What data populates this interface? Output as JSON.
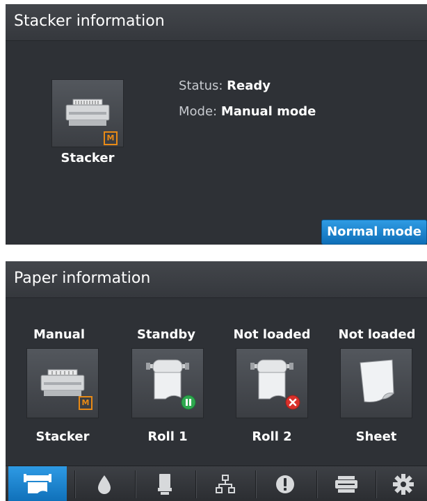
{
  "stacker_panel": {
    "title": "Stacker information",
    "tile_label": "Stacker",
    "badge": "M",
    "status_key": "Status:",
    "status_value": "Ready",
    "mode_key": "Mode:",
    "mode_value": "Manual mode",
    "normal_mode_button": "Normal mode"
  },
  "paper_panel": {
    "title": "Paper information",
    "tiles": [
      {
        "status": "Manual",
        "label": "Stacker",
        "icon": "stacker-icon",
        "badge": "M"
      },
      {
        "status": "Standby",
        "label": "Roll 1",
        "icon": "roll-icon",
        "badge": "pause"
      },
      {
        "status": "Not loaded",
        "label": "Roll 2",
        "icon": "roll-icon",
        "badge": "error"
      },
      {
        "status": "Not loaded",
        "label": "Sheet",
        "icon": "sheet-icon",
        "badge": ""
      }
    ]
  },
  "nav": {
    "items": [
      "paper-icon",
      "ink-drop-icon",
      "printhead-icon",
      "network-icon",
      "alert-icon",
      "printer-icon",
      "settings-gear-icon"
    ],
    "active_index": 0
  },
  "colors": {
    "panel_bg": "#2e3136",
    "accent_blue": "#1a85d0",
    "badge_orange": "#e88a16",
    "pause_green": "#2fa84f",
    "error_red": "#d9312b"
  }
}
